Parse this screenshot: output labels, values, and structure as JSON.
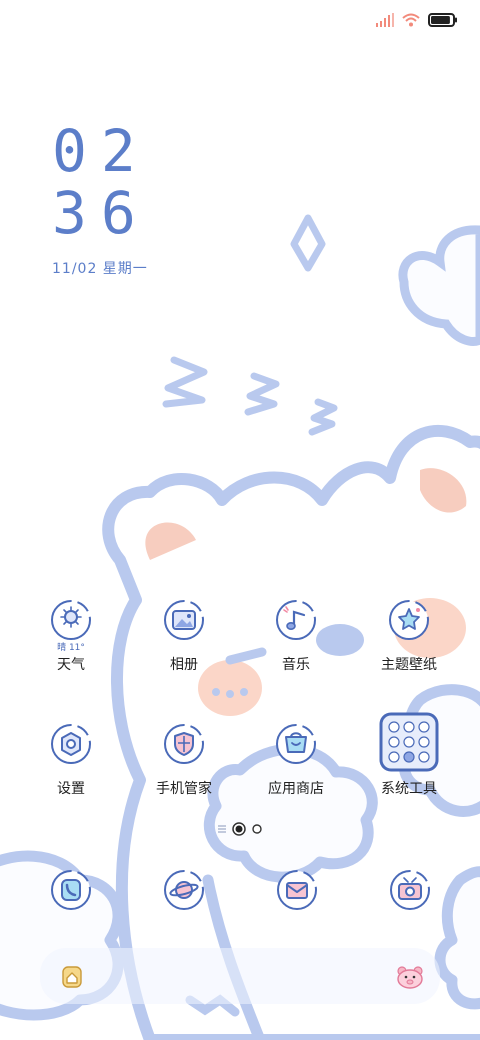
{
  "status_bar": {
    "signal_icon": "signal-bars-icon",
    "wifi_icon": "wifi-icon",
    "battery_icon": "battery-icon",
    "battery_level": 0.9
  },
  "clock": {
    "hours": "02",
    "minutes": "36",
    "date": "11/02 星期一"
  },
  "apps": [
    {
      "label": "天气",
      "icon": "weather-sun-icon",
      "weather": "晴 11°"
    },
    {
      "label": "相册",
      "icon": "gallery-icon"
    },
    {
      "label": "音乐",
      "icon": "music-note-icon"
    },
    {
      "label": "主题壁纸",
      "icon": "theme-star-icon"
    },
    {
      "label": "设置",
      "icon": "settings-gear-icon"
    },
    {
      "label": "手机管家",
      "icon": "phone-manager-shield-icon"
    },
    {
      "label": "应用商店",
      "icon": "app-store-bag-icon"
    },
    {
      "label": "系统工具",
      "icon": "system-tools-folder-icon"
    }
  ],
  "pager": {
    "pages": 2,
    "current": 1
  },
  "dock": [
    {
      "icon": "phone-icon"
    },
    {
      "icon": "browser-planet-icon"
    },
    {
      "icon": "messages-envelope-icon"
    },
    {
      "icon": "camera-icon"
    }
  ],
  "colors": {
    "accent": "#4a6ab8",
    "wallpaper_blue": "#b9c9ee",
    "blush_pink": "#fbd6c8"
  }
}
